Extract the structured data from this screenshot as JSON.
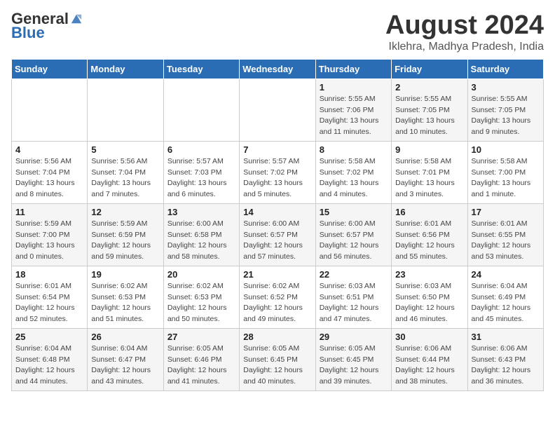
{
  "header": {
    "logo_general": "General",
    "logo_blue": "Blue",
    "title": "August 2024",
    "location": "Iklehra, Madhya Pradesh, India"
  },
  "days_of_week": [
    "Sunday",
    "Monday",
    "Tuesday",
    "Wednesday",
    "Thursday",
    "Friday",
    "Saturday"
  ],
  "weeks": [
    [
      {
        "day": "",
        "info": ""
      },
      {
        "day": "",
        "info": ""
      },
      {
        "day": "",
        "info": ""
      },
      {
        "day": "",
        "info": ""
      },
      {
        "day": "1",
        "info": "Sunrise: 5:55 AM\nSunset: 7:06 PM\nDaylight: 13 hours\nand 11 minutes."
      },
      {
        "day": "2",
        "info": "Sunrise: 5:55 AM\nSunset: 7:05 PM\nDaylight: 13 hours\nand 10 minutes."
      },
      {
        "day": "3",
        "info": "Sunrise: 5:55 AM\nSunset: 7:05 PM\nDaylight: 13 hours\nand 9 minutes."
      }
    ],
    [
      {
        "day": "4",
        "info": "Sunrise: 5:56 AM\nSunset: 7:04 PM\nDaylight: 13 hours\nand 8 minutes."
      },
      {
        "day": "5",
        "info": "Sunrise: 5:56 AM\nSunset: 7:04 PM\nDaylight: 13 hours\nand 7 minutes."
      },
      {
        "day": "6",
        "info": "Sunrise: 5:57 AM\nSunset: 7:03 PM\nDaylight: 13 hours\nand 6 minutes."
      },
      {
        "day": "7",
        "info": "Sunrise: 5:57 AM\nSunset: 7:02 PM\nDaylight: 13 hours\nand 5 minutes."
      },
      {
        "day": "8",
        "info": "Sunrise: 5:58 AM\nSunset: 7:02 PM\nDaylight: 13 hours\nand 4 minutes."
      },
      {
        "day": "9",
        "info": "Sunrise: 5:58 AM\nSunset: 7:01 PM\nDaylight: 13 hours\nand 3 minutes."
      },
      {
        "day": "10",
        "info": "Sunrise: 5:58 AM\nSunset: 7:00 PM\nDaylight: 13 hours\nand 1 minute."
      }
    ],
    [
      {
        "day": "11",
        "info": "Sunrise: 5:59 AM\nSunset: 7:00 PM\nDaylight: 13 hours\nand 0 minutes."
      },
      {
        "day": "12",
        "info": "Sunrise: 5:59 AM\nSunset: 6:59 PM\nDaylight: 12 hours\nand 59 minutes."
      },
      {
        "day": "13",
        "info": "Sunrise: 6:00 AM\nSunset: 6:58 PM\nDaylight: 12 hours\nand 58 minutes."
      },
      {
        "day": "14",
        "info": "Sunrise: 6:00 AM\nSunset: 6:57 PM\nDaylight: 12 hours\nand 57 minutes."
      },
      {
        "day": "15",
        "info": "Sunrise: 6:00 AM\nSunset: 6:57 PM\nDaylight: 12 hours\nand 56 minutes."
      },
      {
        "day": "16",
        "info": "Sunrise: 6:01 AM\nSunset: 6:56 PM\nDaylight: 12 hours\nand 55 minutes."
      },
      {
        "day": "17",
        "info": "Sunrise: 6:01 AM\nSunset: 6:55 PM\nDaylight: 12 hours\nand 53 minutes."
      }
    ],
    [
      {
        "day": "18",
        "info": "Sunrise: 6:01 AM\nSunset: 6:54 PM\nDaylight: 12 hours\nand 52 minutes."
      },
      {
        "day": "19",
        "info": "Sunrise: 6:02 AM\nSunset: 6:53 PM\nDaylight: 12 hours\nand 51 minutes."
      },
      {
        "day": "20",
        "info": "Sunrise: 6:02 AM\nSunset: 6:53 PM\nDaylight: 12 hours\nand 50 minutes."
      },
      {
        "day": "21",
        "info": "Sunrise: 6:02 AM\nSunset: 6:52 PM\nDaylight: 12 hours\nand 49 minutes."
      },
      {
        "day": "22",
        "info": "Sunrise: 6:03 AM\nSunset: 6:51 PM\nDaylight: 12 hours\nand 47 minutes."
      },
      {
        "day": "23",
        "info": "Sunrise: 6:03 AM\nSunset: 6:50 PM\nDaylight: 12 hours\nand 46 minutes."
      },
      {
        "day": "24",
        "info": "Sunrise: 6:04 AM\nSunset: 6:49 PM\nDaylight: 12 hours\nand 45 minutes."
      }
    ],
    [
      {
        "day": "25",
        "info": "Sunrise: 6:04 AM\nSunset: 6:48 PM\nDaylight: 12 hours\nand 44 minutes."
      },
      {
        "day": "26",
        "info": "Sunrise: 6:04 AM\nSunset: 6:47 PM\nDaylight: 12 hours\nand 43 minutes."
      },
      {
        "day": "27",
        "info": "Sunrise: 6:05 AM\nSunset: 6:46 PM\nDaylight: 12 hours\nand 41 minutes."
      },
      {
        "day": "28",
        "info": "Sunrise: 6:05 AM\nSunset: 6:45 PM\nDaylight: 12 hours\nand 40 minutes."
      },
      {
        "day": "29",
        "info": "Sunrise: 6:05 AM\nSunset: 6:45 PM\nDaylight: 12 hours\nand 39 minutes."
      },
      {
        "day": "30",
        "info": "Sunrise: 6:06 AM\nSunset: 6:44 PM\nDaylight: 12 hours\nand 38 minutes."
      },
      {
        "day": "31",
        "info": "Sunrise: 6:06 AM\nSunset: 6:43 PM\nDaylight: 12 hours\nand 36 minutes."
      }
    ]
  ]
}
